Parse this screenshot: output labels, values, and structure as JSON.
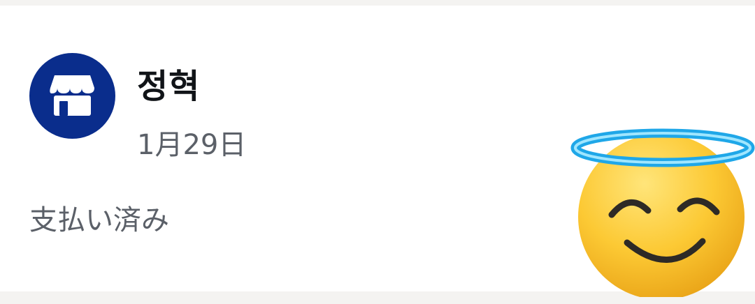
{
  "transaction": {
    "merchant_name": "정혁",
    "date": "1月29日",
    "status": "支払い済み"
  },
  "icons": {
    "avatar": "store-icon",
    "sticker": "smiling-face-with-halo-emoji"
  },
  "colors": {
    "avatar_background": "#0a2d8c",
    "title_text": "#111418",
    "secondary_text": "#5b6068"
  }
}
